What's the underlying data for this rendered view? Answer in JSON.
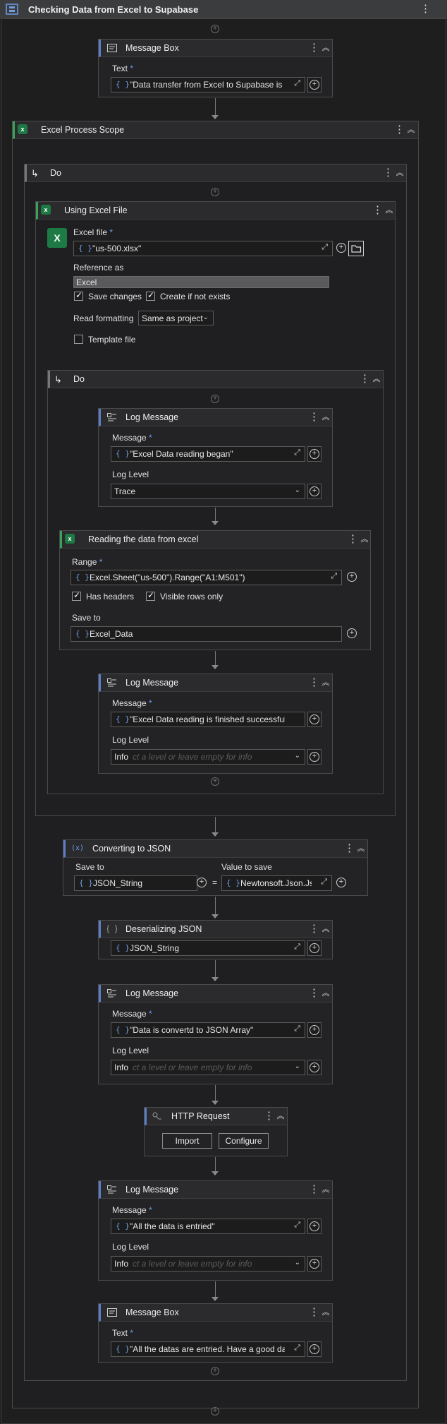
{
  "title": "Checking Data from Excel to Supabase",
  "msgbox1": {
    "title": "Message Box",
    "text_label": "Text",
    "text_value": "\"Data transfer from Excel to Supabase is re"
  },
  "scope": {
    "title": "Excel Process Scope"
  },
  "do_outer": {
    "title": "Do"
  },
  "using_excel": {
    "title": "Using Excel File",
    "file_label": "Excel file",
    "file_value": "\"us-500.xlsx\"",
    "ref_label": "Reference as",
    "ref_value": "Excel",
    "save_changes": "Save changes",
    "create_if_not_exists": "Create if not exists",
    "read_formatting_label": "Read formatting",
    "read_formatting_value": "Same as project",
    "template_file": "Template file"
  },
  "do_inner": {
    "title": "Do"
  },
  "log1": {
    "title": "Log Message",
    "message_label": "Message",
    "message_value": "\"Excel Data reading began\"",
    "level_label": "Log Level",
    "level_value": "Trace"
  },
  "read_range": {
    "title": "Reading the data from excel",
    "range_label": "Range",
    "range_value": "Excel.Sheet(\"us-500\").Range(\"A1:M501\")",
    "has_headers": "Has headers",
    "visible_rows_only": "Visible rows only",
    "save_to_label": "Save to",
    "save_to_value": "Excel_Data"
  },
  "log2": {
    "title": "Log Message",
    "message_label": "Message",
    "message_value": "\"Excel Data reading is finished successfully",
    "level_label": "Log Level",
    "level_value": "Info",
    "level_placeholder": "ct a level or leave empty for info"
  },
  "convert": {
    "title": "Converting to JSON",
    "save_to_label": "Save to",
    "value_label": "Value to save",
    "save_to_value": "JSON_String",
    "equals": "=",
    "value_value": "Newtonsoft.Json.JsonC"
  },
  "deserialize": {
    "title": "Deserializing JSON",
    "value": "JSON_String"
  },
  "log3": {
    "title": "Log Message",
    "message_label": "Message",
    "message_value": "\"Data is convertd to JSON Array\"",
    "level_label": "Log Level",
    "level_value": "Info",
    "level_placeholder": "ct a level or leave empty for info"
  },
  "http": {
    "title": "HTTP Request",
    "import": "Import",
    "configure": "Configure"
  },
  "log4": {
    "title": "Log Message",
    "message_label": "Message",
    "message_value": "\"All the data is entried\"",
    "level_label": "Log Level",
    "level_value": "Info",
    "level_placeholder": "ct a level or leave empty for info"
  },
  "msgbox2": {
    "title": "Message Box",
    "text_label": "Text",
    "text_value": "\"All the datas are entried. Have a good day"
  },
  "common": {
    "required_mark": "*",
    "plus": "+",
    "brace": "{ }",
    "expand": "⤢",
    "kebab": "⋮",
    "collapse": "︽",
    "chevron": "⌄"
  }
}
